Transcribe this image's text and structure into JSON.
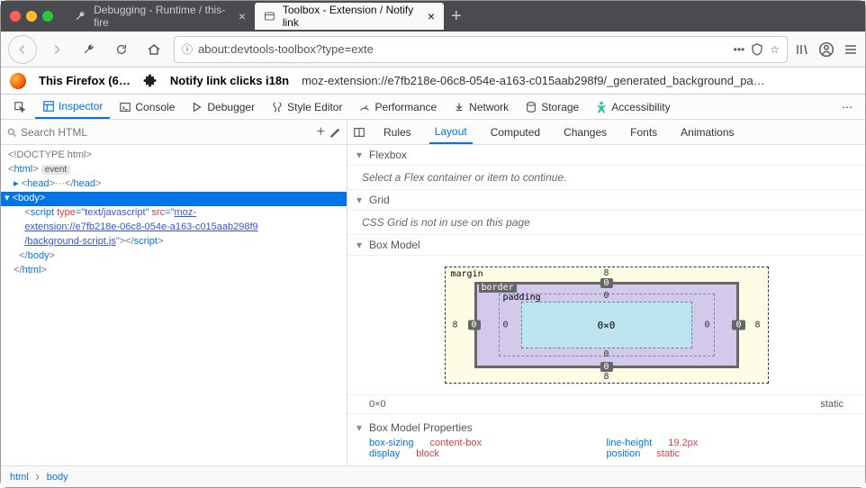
{
  "titlebar": {
    "tabs": [
      {
        "label": "Debugging - Runtime / this-fire",
        "active": false
      },
      {
        "label": "Toolbox - Extension / Notify link",
        "active": true
      }
    ]
  },
  "navbar": {
    "url": "about:devtools-toolbox?type=exte"
  },
  "infobar": {
    "this_firefox": "This Firefox (6…",
    "ext_name": "Notify link clicks i18n",
    "ext_path": "moz-extension://e7fb218e-06c8-054e-a163-c015aab298f9/_generated_background_pa…"
  },
  "devtools_tabs": [
    "Inspector",
    "Console",
    "Debugger",
    "Style Editor",
    "Performance",
    "Network",
    "Storage",
    "Accessibility"
  ],
  "devtools_active": "Inspector",
  "sidepanel_tabs": [
    "Rules",
    "Layout",
    "Computed",
    "Changes",
    "Fonts",
    "Animations"
  ],
  "sidepanel_active": "Layout",
  "search_html": {
    "placeholder": "Search HTML"
  },
  "html_tree": {
    "doctype": "<!DOCTYPE html>",
    "html_open": "html",
    "event": "event",
    "head": "head",
    "body": "body",
    "script_attr_type": "type",
    "script_type_val": "text/javascript",
    "script_attr_src": "src",
    "script_src_val": "moz-extension://e7fb218e-06c8-054e-a163-c015aab298f9/background-script.js",
    "html_close": "html"
  },
  "layout": {
    "flexbox_title": "Flexbox",
    "flexbox_msg": "Select a Flex container or item to continue.",
    "grid_title": "Grid",
    "grid_msg": "CSS Grid is not in use on this page",
    "box_model_title": "Box Model",
    "bm_margin_label": "margin",
    "bm_border_label": "border",
    "bm_padding_label": "padding",
    "bm_content": "0×0",
    "bm_margin": {
      "top": "8",
      "right": "8",
      "bottom": "8",
      "left": "8"
    },
    "bm_border": {
      "top": "0",
      "right": "0",
      "bottom": "0",
      "left": "0"
    },
    "bm_padding": {
      "top": "0",
      "right": "0",
      "bottom": "0",
      "left": "0"
    },
    "bm_size": "0×0",
    "bm_pos": "static",
    "bm_props_title": "Box Model Properties",
    "props": [
      {
        "name": "box-sizing",
        "val": "content-box"
      },
      {
        "name": "display",
        "val": "block"
      },
      {
        "name": "line-height",
        "val": "19.2px"
      },
      {
        "name": "position",
        "val": "static"
      }
    ]
  },
  "breadcrumb": [
    "html",
    "body"
  ]
}
